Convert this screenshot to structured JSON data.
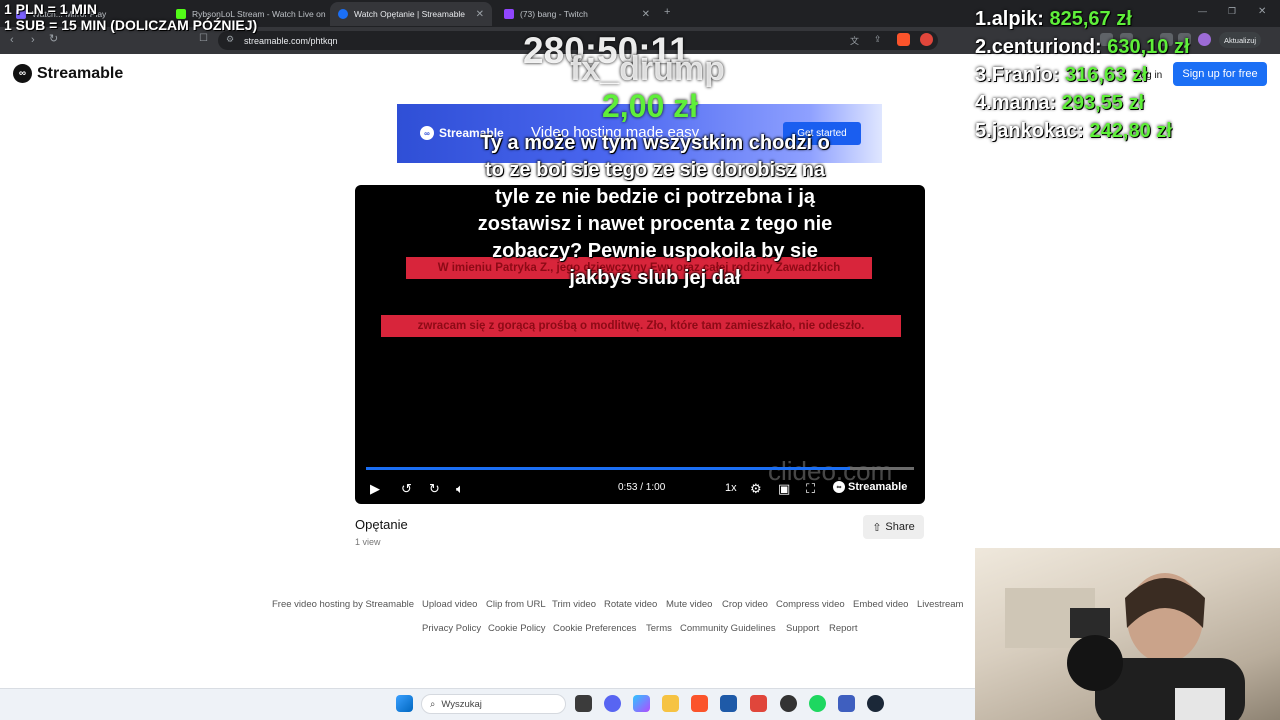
{
  "browser": {
    "tabs": [
      {
        "label": "Watch... Mirror Play"
      },
      {
        "label": "RybsonLoL Stream - Watch Live on K"
      },
      {
        "label": "Watch Opętanie | Streamable"
      },
      {
        "label": "(73) bang - Twitch"
      }
    ],
    "url": "streamable.com/phtkqn",
    "update_label": "Aktualizuj"
  },
  "site": {
    "brand": "Streamable",
    "login": "Log in",
    "signup": "Sign up for free"
  },
  "banner": {
    "brand": "Streamable",
    "tagline": "Video hosting made easy",
    "cta": "Get started"
  },
  "player": {
    "time": "0:53 / 1:00",
    "progress": 0.8833,
    "speed": "1x",
    "brand": "Streamable",
    "watermark": "clideo.com",
    "red_line_1": "W imieniu Patryka Z., jego dziewczyny Ewy oraz całej rodziny Zawadzkich",
    "red_line_2": "zwracam się z gorącą prośbą o modlitwę. Zło, które tam zamieszkało, nie odeszło."
  },
  "video": {
    "title": "Opętanie",
    "views": "1 view",
    "share": "Share"
  },
  "footer": {
    "row1": [
      "Free video hosting by Streamable",
      "Upload video",
      "Clip from URL",
      "Trim video",
      "Rotate video",
      "Mute video",
      "Crop video",
      "Compress video",
      "Embed video",
      "Livestream"
    ],
    "row2": [
      "Privacy Policy",
      "Cookie Policy",
      "Cookie Preferences",
      "Terms",
      "Community Guidelines",
      "Support",
      "Report"
    ]
  },
  "overlay": {
    "rules_line1": "1 PLN = 1 MIN",
    "rules_line2": "1 SUB = 15 MIN (DOLICZAM PÓŹNIEJ)",
    "timer": "280:50:11",
    "donor_name": "fx_drump",
    "donor_amount": "2,00 zł",
    "caption": "Ty a może w tym wszystkim chodzi o to ze boi sie tego ze sie dorobisz na tyle ze nie bedzie ci potrzebna i ją zostawisz i nawet procenta z tego nie zobaczy? Pewnie uspokoila by sie jakbys slub jej dał",
    "leaderboard": [
      {
        "rank": "1.",
        "name": "alpik:",
        "amount": "825,67 zł"
      },
      {
        "rank": "2.",
        "name": "centuriond:",
        "amount": "630,10 zł"
      },
      {
        "rank": "3.",
        "name": "Franio:",
        "amount": "316,63 zł"
      },
      {
        "rank": "4.",
        "name": "mama:",
        "amount": "293,55 zł"
      },
      {
        "rank": "5.",
        "name": "jankokac:",
        "amount": "242,80 zł"
      }
    ]
  },
  "taskbar": {
    "search_placeholder": "Wyszukaj"
  },
  "colors": {
    "accent": "#1b6ff5",
    "donation_green": "#5fef3a",
    "alert_red": "#d8253b"
  }
}
